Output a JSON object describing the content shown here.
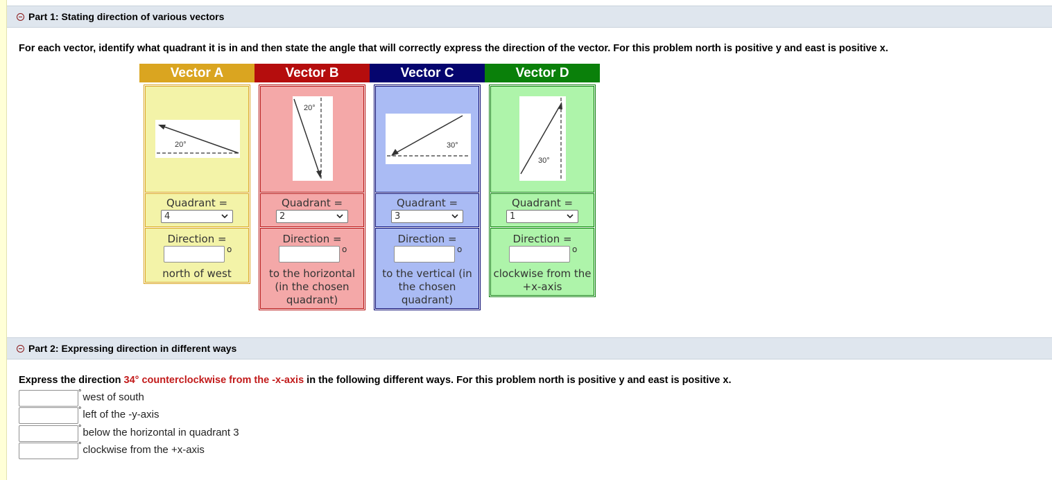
{
  "part1": {
    "title": "Part 1: Stating direction of various vectors",
    "instruction": "For each vector, identify what quadrant it is in and then state the angle that will correctly express the direction of the vector. For this problem north is positive y and east is positive x.",
    "vectors": [
      {
        "name": "Vector A",
        "angle_label": "20°",
        "quadrant_label": "Quadrant =",
        "quadrant_value": "4",
        "direction_label": "Direction =",
        "direction_value": "",
        "degree_symbol": "o",
        "direction_suffix": "north of west",
        "color": "#daa520",
        "fill": "#f3f3a8"
      },
      {
        "name": "Vector B",
        "angle_label": "20°",
        "quadrant_label": "Quadrant =",
        "quadrant_value": "2",
        "direction_label": "Direction =",
        "direction_value": "",
        "degree_symbol": "o",
        "direction_suffix": "to the horizontal (in the chosen quadrant)",
        "color": "#b50d0d",
        "fill": "#f4a8a8"
      },
      {
        "name": "Vector C",
        "angle_label": "30°",
        "quadrant_label": "Quadrant =",
        "quadrant_value": "3",
        "direction_label": "Direction =",
        "direction_value": "",
        "degree_symbol": "o",
        "direction_suffix": "to the vertical (in the chosen quadrant)",
        "color": "#05056e",
        "fill": "#aabbf4"
      },
      {
        "name": "Vector D",
        "angle_label": "30°",
        "quadrant_label": "Quadrant =",
        "quadrant_value": "1",
        "direction_label": "Direction =",
        "direction_value": "",
        "degree_symbol": "o",
        "direction_suffix": "clockwise from the +x-axis",
        "color": "#0a800a",
        "fill": "#aef4aa"
      }
    ]
  },
  "part2": {
    "title": "Part 2: Expressing direction in different ways",
    "instruction_prefix": "Express the direction ",
    "instruction_highlight": "34° counterclockwise from the -x-axis",
    "instruction_suffix": " in the following different ways. For this problem north is positive y and east is positive x.",
    "degree_symbol": "°",
    "answers": [
      {
        "value": "",
        "label": "west of south"
      },
      {
        "value": "",
        "label": "left of the -y-axis"
      },
      {
        "value": "",
        "label": "below the horizontal in quadrant 3"
      },
      {
        "value": "",
        "label": "clockwise from the +x-axis"
      }
    ]
  }
}
